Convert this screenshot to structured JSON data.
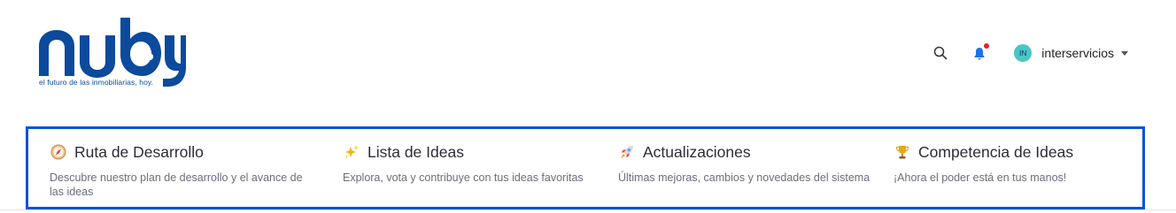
{
  "header": {
    "logo_text": "nuby",
    "tagline": "el futuro de las inmobiliarias, hoy.",
    "user": {
      "initials": "IN",
      "name": "interservicios"
    },
    "has_notification": true
  },
  "menu": {
    "items": [
      {
        "icon": "compass-icon",
        "label": "Ruta de Desarrollo",
        "description": "Descubre nuestro plan de desarrollo y el avance de las ideas"
      },
      {
        "icon": "sparkles-icon",
        "label": "Lista de Ideas",
        "description": "Explora, vota y contribuye con tus ideas favoritas"
      },
      {
        "icon": "rocket-icon",
        "label": "Actualizaciones",
        "description": "Últimas mejoras, cambios y novedades del sistema"
      },
      {
        "icon": "trophy-icon",
        "label": "Competencia de Ideas",
        "description": "¡Ahora el poder está en tus manos!"
      }
    ]
  },
  "colors": {
    "brand": "#0b4a9c",
    "accent_border": "#0b52d8",
    "avatar": "#4bc6c6",
    "notification": "#e3222b"
  }
}
